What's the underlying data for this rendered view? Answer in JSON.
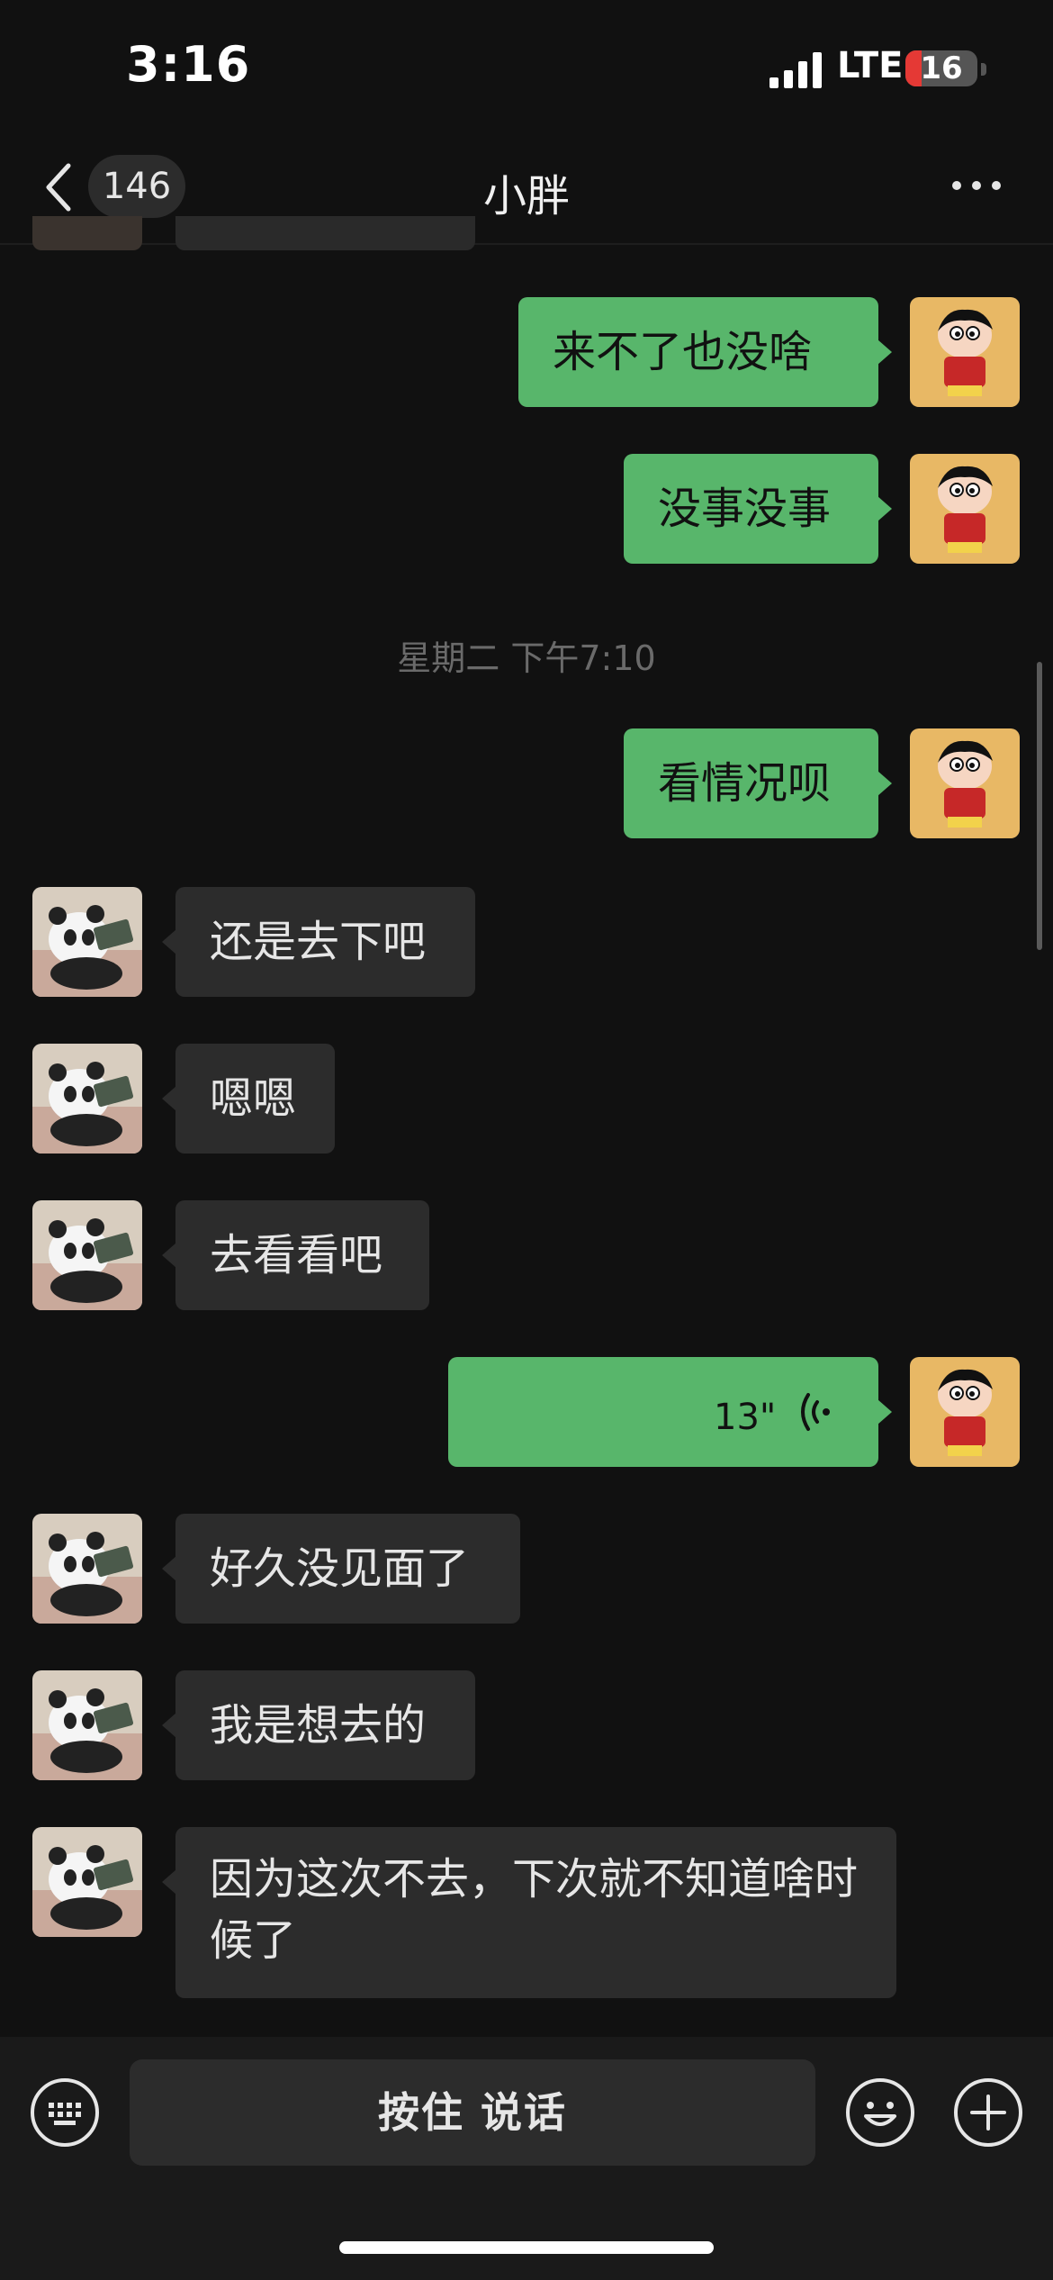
{
  "status_bar": {
    "time": "3:16",
    "network": "LTE",
    "battery": "16"
  },
  "nav": {
    "back_count": "146",
    "title": "小胖"
  },
  "timestamp": "星期二 下午7:10",
  "messages": [
    {
      "dir": "out",
      "text": "来不了也没啥"
    },
    {
      "dir": "out",
      "text": "没事没事"
    },
    {
      "dir": "out",
      "text": "看情况呗"
    },
    {
      "dir": "in",
      "text": "还是去下吧"
    },
    {
      "dir": "in",
      "text": "嗯嗯"
    },
    {
      "dir": "in",
      "text": "去看看吧"
    },
    {
      "dir": "out",
      "type": "voice",
      "duration": "13\""
    },
    {
      "dir": "in",
      "text": "好久没见面了"
    },
    {
      "dir": "in",
      "text": "我是想去的"
    },
    {
      "dir": "in",
      "text": "因为这次不去，下次就不知道啥时候了"
    }
  ],
  "input_bar": {
    "talk_label": "按住 说话"
  },
  "icons": {
    "keyboard": "keyboard-icon",
    "emoji": "emoji-icon",
    "plus": "plus-icon",
    "back": "chevron-left-icon",
    "more": "more-icon",
    "voice": "voice-wave-icon"
  },
  "colors": {
    "outgoing_bubble": "#58b66b",
    "incoming_bubble": "#2c2c2c",
    "background": "#111111"
  }
}
